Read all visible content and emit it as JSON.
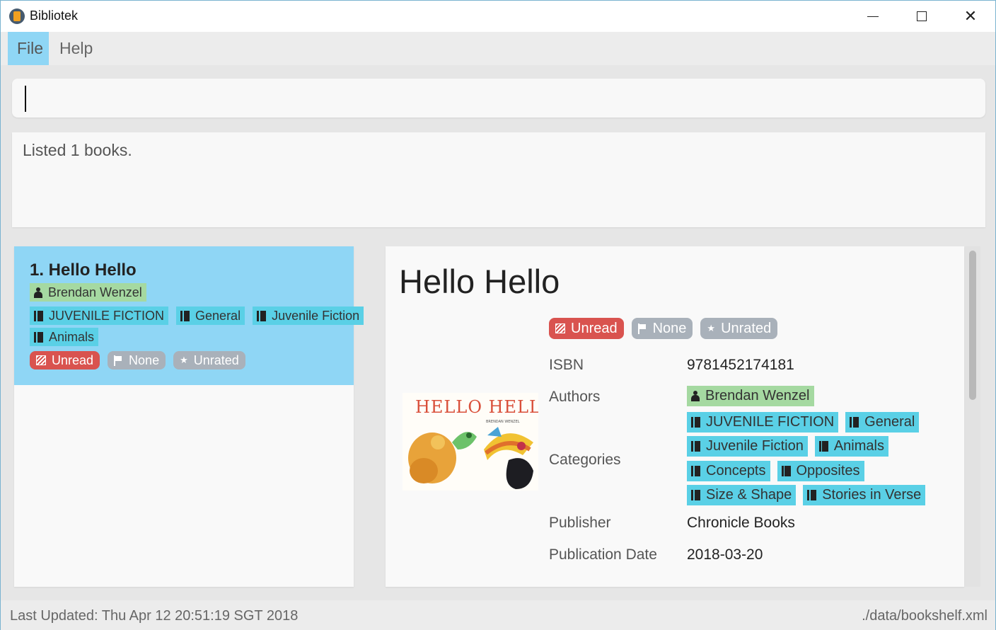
{
  "window": {
    "title": "Bibliotek"
  },
  "menu": {
    "file": "File",
    "help": "Help"
  },
  "command": {
    "value": ""
  },
  "result": {
    "message": "Listed 1 books."
  },
  "list": {
    "card": {
      "title": "1. Hello Hello",
      "author": "Brendan Wenzel",
      "categories": [
        "JUVENILE FICTION",
        "General",
        "Juvenile Fiction",
        "Animals"
      ],
      "status": "Unread",
      "priority": "None",
      "rating": "Unrated"
    }
  },
  "detail": {
    "title": "Hello Hello",
    "status": "Unread",
    "priority": "None",
    "rating": "Unrated",
    "labels": {
      "isbn": "ISBN",
      "authors": "Authors",
      "categories": "Categories",
      "publisher": "Publisher",
      "pubdate": "Publication Date"
    },
    "isbn": "9781452174181",
    "author": "Brendan Wenzel",
    "categories": [
      "JUVENILE FICTION",
      "General",
      "Juvenile Fiction",
      "Animals",
      "Concepts",
      "Opposites",
      "Size & Shape",
      "Stories in Verse"
    ],
    "publisher": "Chronicle Books",
    "pubdate": "2018-03-20",
    "cover_text": "HELLO HELLO"
  },
  "statusbar": {
    "last_updated": "Last Updated: Thu Apr 12 20:51:19 SGT 2018",
    "file_path": "./data/bookshelf.xml"
  },
  "colors": {
    "selection": "#8fd6f5",
    "author_tag": "#a5d9a1",
    "category_tag": "#5ad0e6",
    "status_unread": "#d9534f",
    "neutral_tag": "#a9b1ba"
  },
  "icons": {
    "author": "person-icon",
    "category": "book-icon",
    "status": "unread-icon",
    "priority": "flag-icon",
    "rating": "star-icon"
  }
}
